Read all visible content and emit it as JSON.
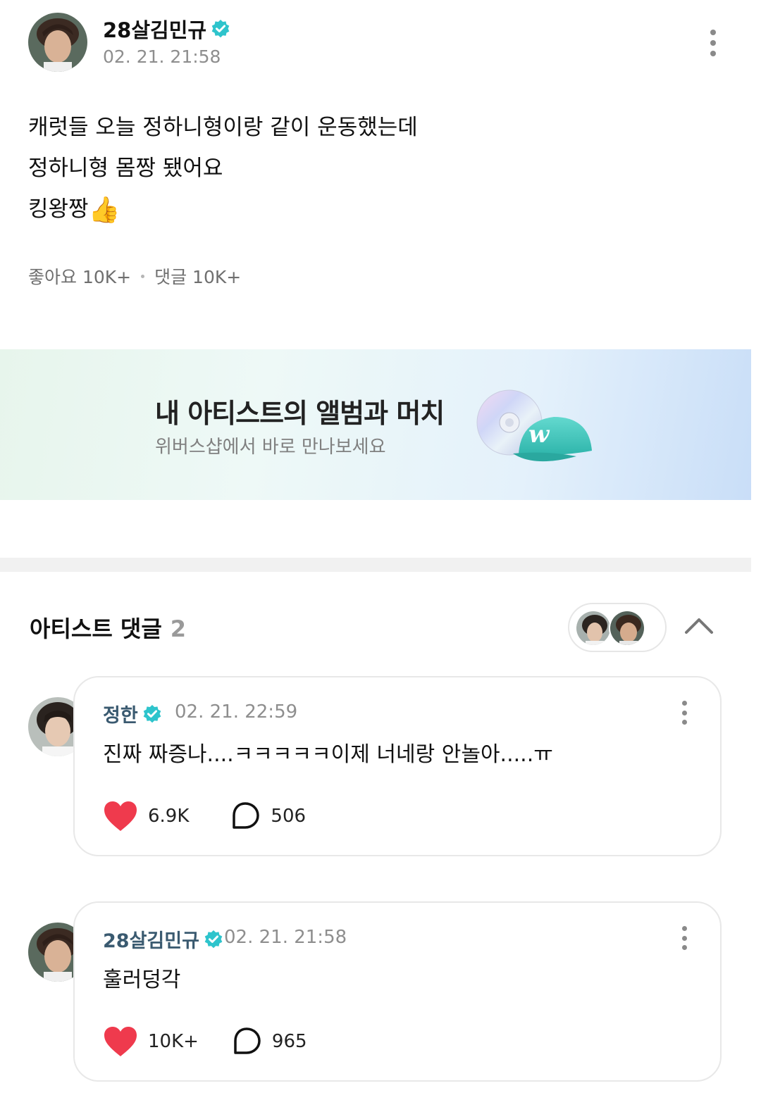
{
  "post": {
    "author": "28살김민규",
    "date": "02. 21. 21:58",
    "lines": [
      "캐럿들 오늘 정하니형이랑 같이 운동했는데",
      "정하니형 몸짱 됐어요",
      "킹왕짱"
    ],
    "emoji": "👍",
    "likes_label": "좋아요 10K+",
    "comments_label": "댓글 10K+"
  },
  "banner": {
    "title": "내 아티스트의 앨범과 머치",
    "subtitle": "위버스샵에서 바로 만나보세요"
  },
  "artist_comments": {
    "title": "아티스트 댓글",
    "count": "2",
    "items": [
      {
        "name": "정한",
        "date": "02. 21. 22:59",
        "text": "진짜 짜증나....ㅋㅋㅋㅋㅋ이제 너네랑 안놀아.....ㅠ",
        "likes": "6.9K",
        "replies": "506"
      },
      {
        "name": "28살김민규",
        "date": "02. 21. 21:58",
        "text": "훌러덩각",
        "likes": "10K+",
        "replies": "965"
      }
    ]
  },
  "colors": {
    "verified": "#2ec4cc",
    "heart": "#ef3a4d",
    "stat_text": "#6f6f6f"
  },
  "icons": [
    "verified-badge-icon",
    "more-vertical-icon",
    "thumbs-up-emoji",
    "heart-icon",
    "comment-bubble-icon",
    "chevron-up-icon",
    "cd-icon",
    "cap-icon"
  ]
}
